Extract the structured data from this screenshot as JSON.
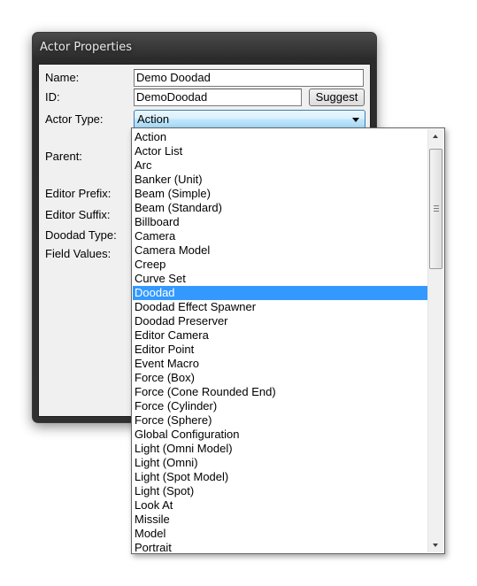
{
  "window": {
    "title": "Actor Properties"
  },
  "form": {
    "name_label": "Name:",
    "name_value": "Demo Doodad",
    "id_label": "ID:",
    "id_value": "DemoDoodad",
    "suggest_label": "Suggest",
    "actor_type_label": "Actor Type:",
    "actor_type_value": "Action",
    "parent_label": "Parent:",
    "editor_prefix_label": "Editor Prefix:",
    "editor_suffix_label": "Editor Suffix:",
    "doodad_type_label": "Doodad Type:",
    "field_values_label": "Field Values:"
  },
  "dropdown": {
    "selected": "Doodad",
    "items": [
      "Action",
      "Actor List",
      "Arc",
      "Banker (Unit)",
      "Beam (Simple)",
      "Beam (Standard)",
      "Billboard",
      "Camera",
      "Camera Model",
      "Creep",
      "Curve Set",
      "Doodad",
      "Doodad Effect Spawner",
      "Doodad Preserver",
      "Editor Camera",
      "Editor Point",
      "Event Macro",
      "Force (Box)",
      "Force (Cone Rounded End)",
      "Force (Cylinder)",
      "Force (Sphere)",
      "Global Configuration",
      "Light (Omni Model)",
      "Light (Omni)",
      "Light (Spot Model)",
      "Light (Spot)",
      "Look At",
      "Missile",
      "Model",
      "Portrait"
    ]
  },
  "colors": {
    "selection": "#3399ff",
    "window_frame": "#2b2b2b"
  },
  "icons": {
    "combo_arrow": "chevron-down-icon",
    "scroll_up": "arrow-up-icon",
    "scroll_down": "arrow-down-icon"
  }
}
